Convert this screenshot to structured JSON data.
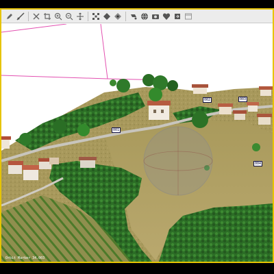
{
  "toolbar": {
    "icons": [
      "pencil-tool-icon",
      "measure-tool-icon",
      "close-icon",
      "crop-icon",
      "zoom-in-icon",
      "zoom-out-icon",
      "move-icon",
      "grid-icon",
      "diamond-icon",
      "nodes-icon",
      "layers-icon",
      "globe-icon",
      "camera-icon",
      "heart-shield-icon",
      "share-icon",
      "window-icon"
    ]
  },
  "scene": {
    "waypoints": [
      "001",
      "002",
      "003",
      "004"
    ],
    "status_text": "Orbit Marker 34.003"
  },
  "colors": {
    "accent_border": "#e6c400",
    "flight_path": "#e24fb0",
    "field": "#b5a46a",
    "trees": "#2f7a2a"
  }
}
